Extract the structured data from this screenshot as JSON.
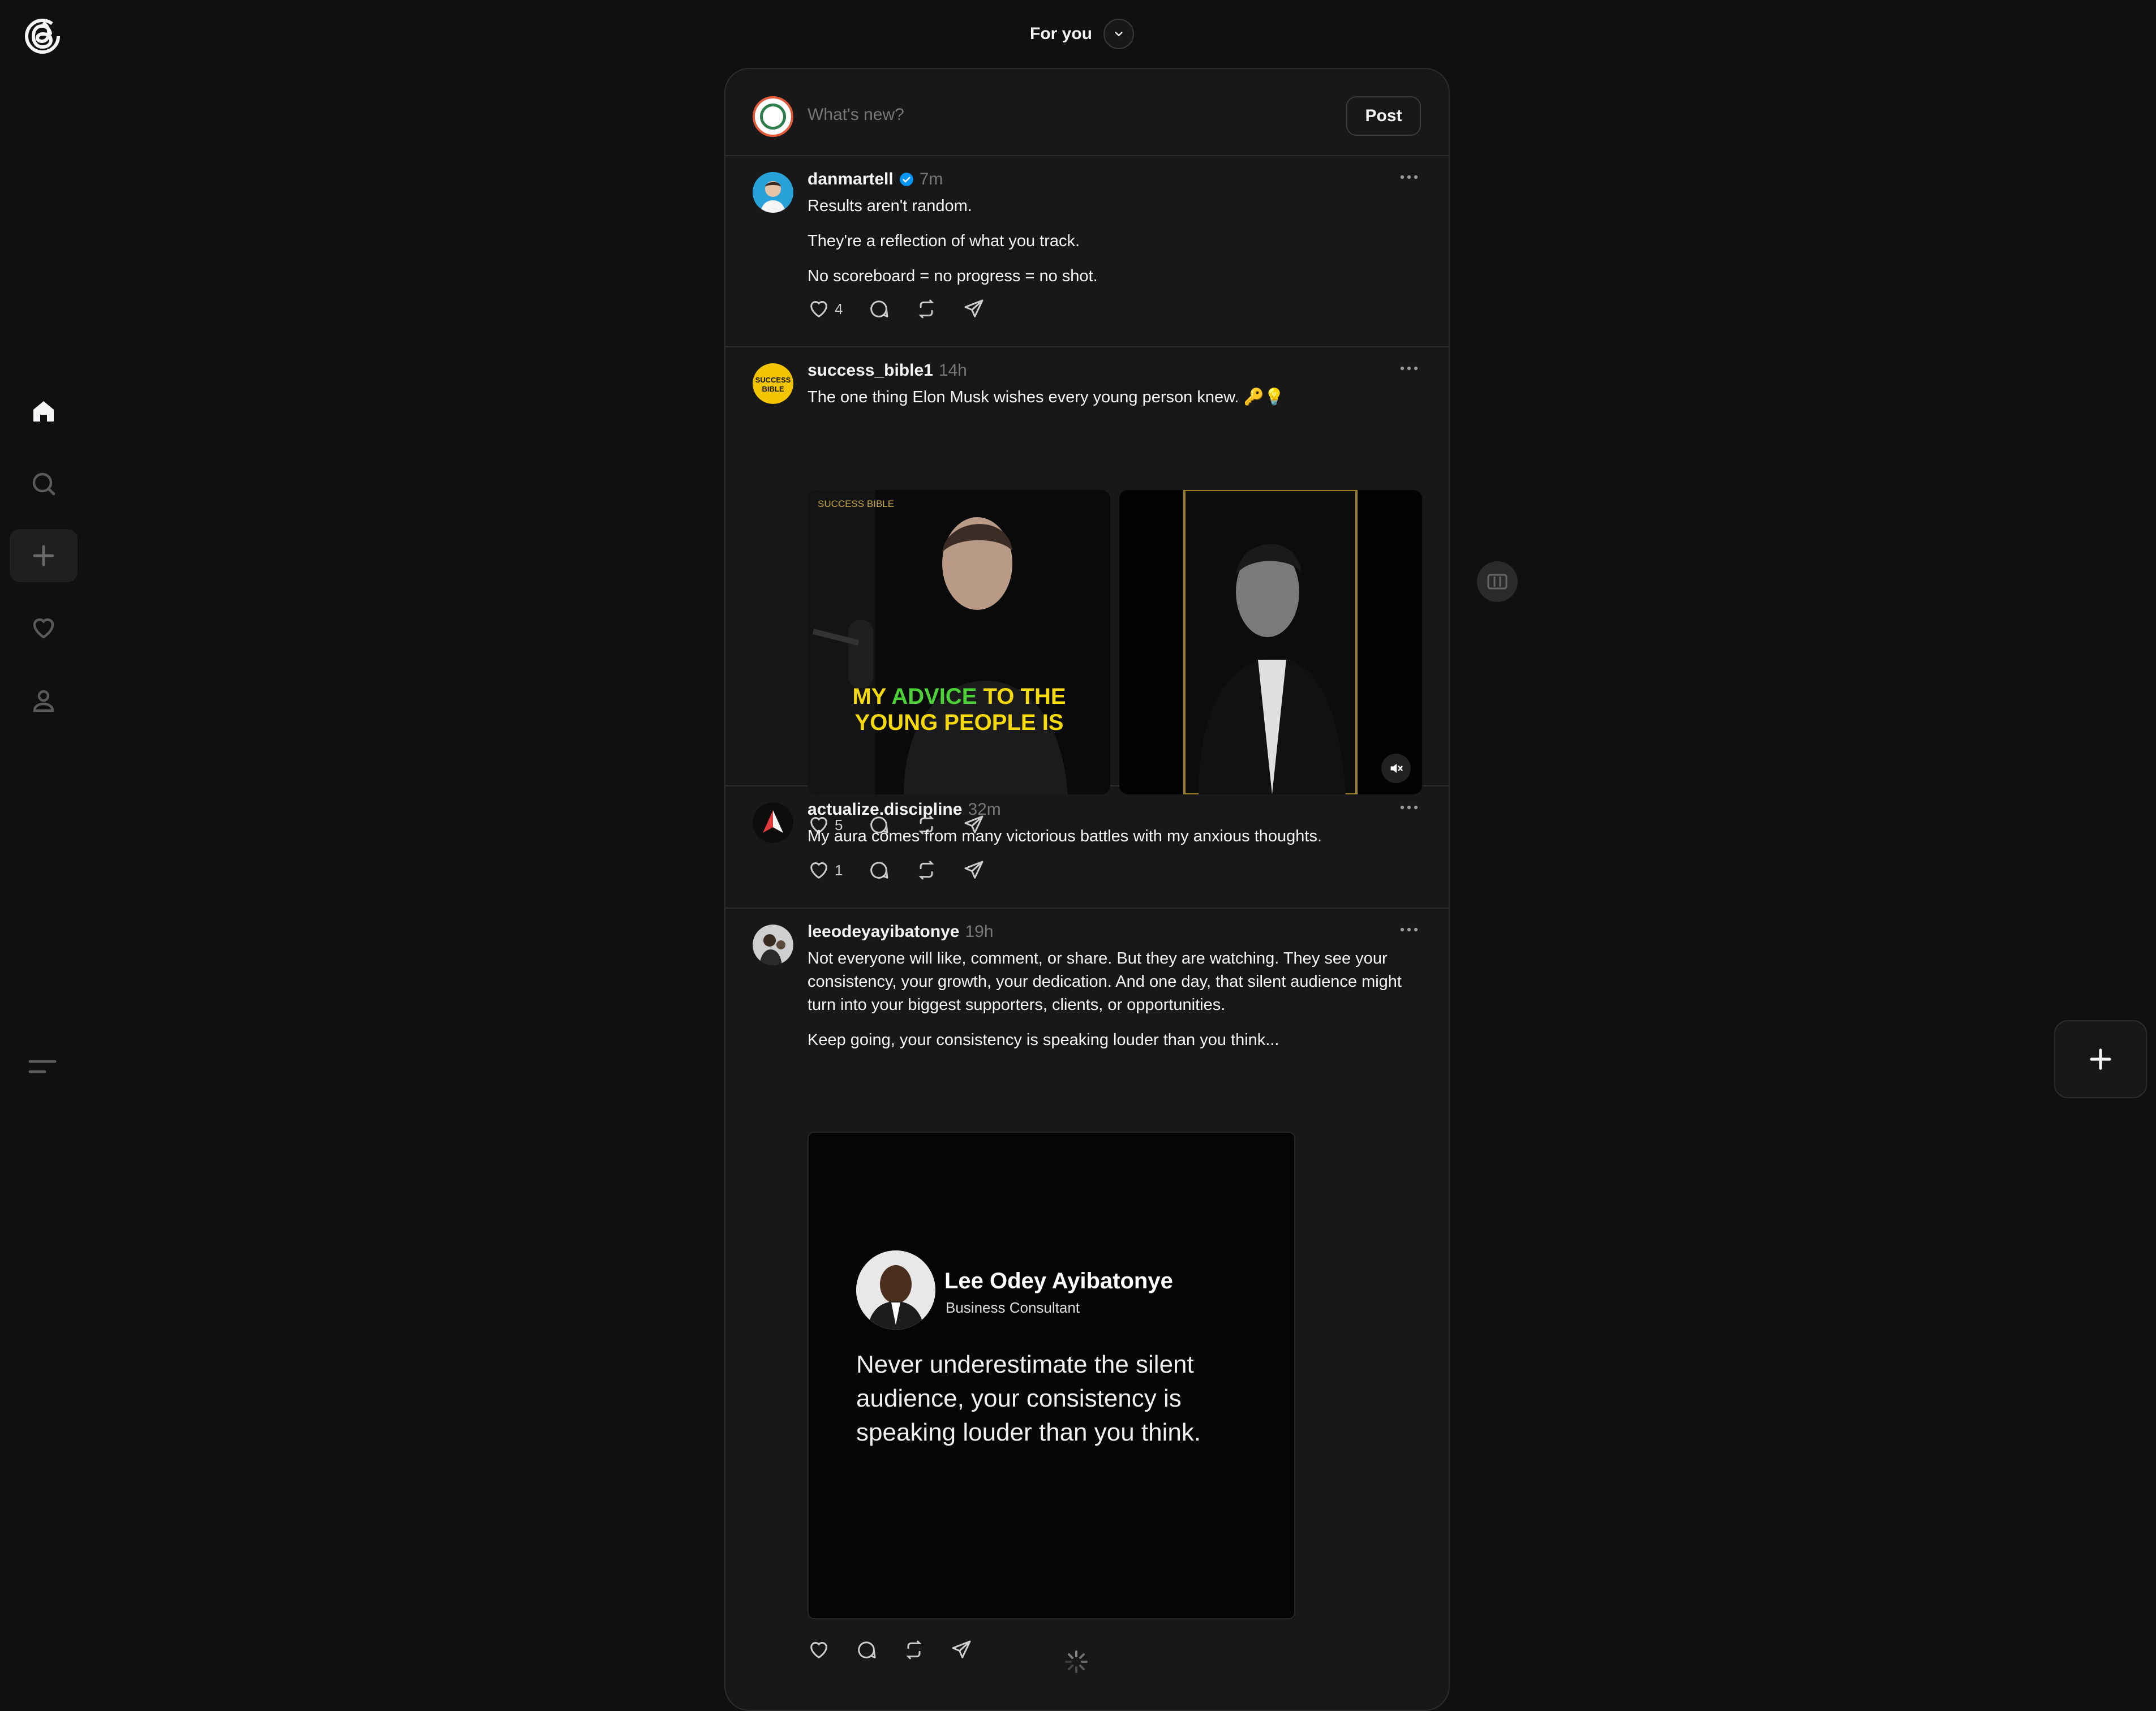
{
  "header": {
    "feed_title": "For you"
  },
  "composer": {
    "placeholder": "What's new?",
    "post_label": "Post"
  },
  "posts": [
    {
      "username": "danmartell",
      "verified": true,
      "time": "7m",
      "paragraphs": [
        "Results aren't random.",
        "They're a reflection of what you track.",
        "No scoreboard = no progress = no shot."
      ],
      "likes": "4"
    },
    {
      "username": "success_bible1",
      "time": "14h",
      "paragraphs": [
        "The one thing Elon Musk wishes every young person knew. 🔑💡"
      ],
      "likes": "5",
      "media": {
        "watermark": "SUCCESS BIBLE",
        "caption_line1_a": "MY ",
        "caption_line1_b": "ADVICE",
        "caption_line1_c": " TO THE",
        "caption_line2": "YOUNG PEOPLE IS"
      }
    },
    {
      "username": "actualize.discipline",
      "time": "32m",
      "paragraphs": [
        "My aura comes from many victorious battles with my anxious thoughts."
      ],
      "likes": "1"
    },
    {
      "username": "leeodeyayibatonye",
      "time": "19h",
      "paragraphs": [
        "Not everyone will like, comment, or share. But they are watching. They see your consistency, your growth, your dedication. And one day, that silent audience might turn into your biggest supporters, clients, or opportunities.",
        "Keep going, your consistency is speaking louder than you think..."
      ],
      "likes": "",
      "card": {
        "name": "Lee Odey Ayibatonye",
        "role": "Business Consultant",
        "quote": "Never underestimate the silent audience, your consistency is speaking louder than you think."
      }
    }
  ],
  "icons": [
    "threads-logo-icon",
    "home-icon",
    "search-icon",
    "create-icon",
    "heart-icon",
    "profile-icon",
    "menu-icon",
    "chevron-down-icon",
    "more-icon",
    "like-icon",
    "comment-icon",
    "repost-icon",
    "share-icon",
    "mute-icon",
    "columns-icon",
    "plus-icon",
    "spinner-icon"
  ],
  "colors": {
    "background": "#101010",
    "card": "#181818",
    "verified": "#0095f6",
    "caption_yellow": "#f5d90a",
    "caption_green": "#4cd137"
  }
}
